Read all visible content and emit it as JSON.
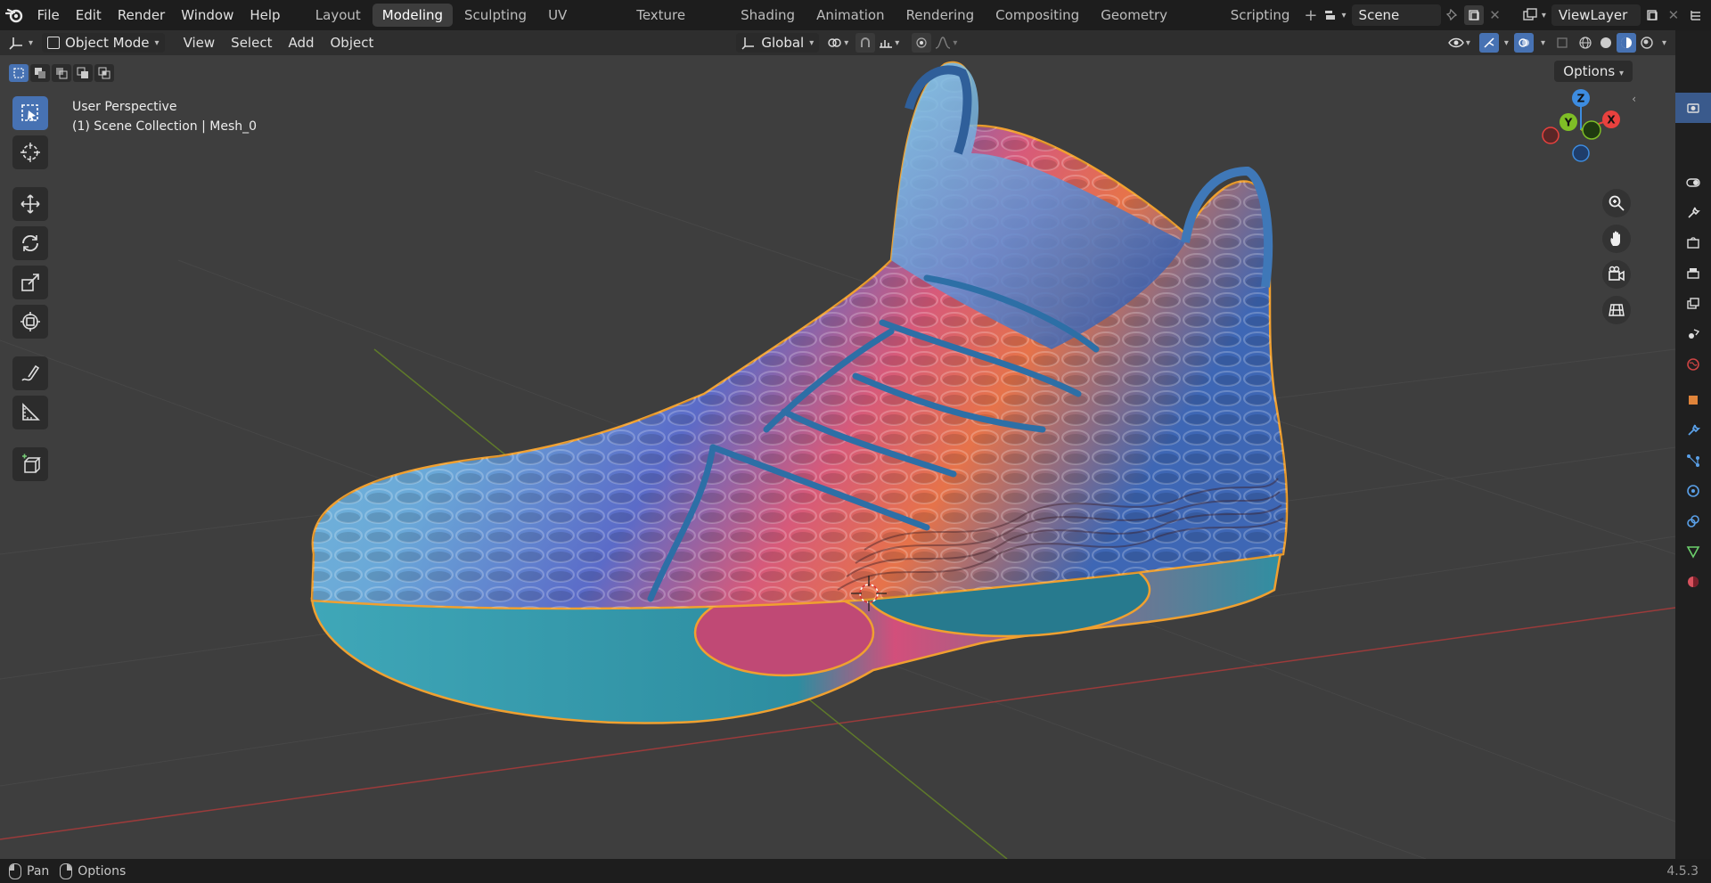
{
  "menus": [
    "File",
    "Edit",
    "Render",
    "Window",
    "Help"
  ],
  "workspace_tabs": [
    "Layout",
    "Modeling",
    "Sculpting",
    "UV Editing",
    "Texture Paint",
    "Shading",
    "Animation",
    "Rendering",
    "Compositing",
    "Geometry Nodes",
    "Scripting"
  ],
  "active_workspace": "Modeling",
  "scene": {
    "name": "Scene"
  },
  "view_layer": {
    "name": "ViewLayer"
  },
  "header": {
    "mode": "Object Mode",
    "menus": [
      "View",
      "Select",
      "Add",
      "Object"
    ],
    "transform_orientation": "Global"
  },
  "viewport": {
    "perspective_label": "User Perspective",
    "collection_label": "(1) Scene Collection | Mesh_0",
    "options_label": "Options",
    "gizmo": {
      "z": "Z",
      "y": "Y",
      "x": "X"
    }
  },
  "statusbar": {
    "pan_label": "Pan",
    "options_label": "Options",
    "version": "4.5.3"
  },
  "colors": {
    "accent": "#4772b3",
    "selection_outline": "#f0a030",
    "axis_x": "#e8413e",
    "axis_y": "#7fbf26",
    "axis_z": "#3d8ce0"
  }
}
